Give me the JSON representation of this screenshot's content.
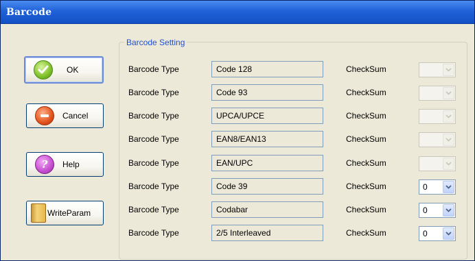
{
  "window": {
    "title": "Barcode"
  },
  "buttons": {
    "ok": {
      "label": "OK",
      "icon": "checkmark-icon"
    },
    "cancel": {
      "label": "Cancel",
      "icon": "minus-icon"
    },
    "help": {
      "label": "Help",
      "icon": "question-icon"
    },
    "write_param": {
      "label": "WriteParam",
      "icon": "book-icon"
    }
  },
  "group": {
    "legend": "Barcode Setting"
  },
  "rows": [
    {
      "label": "Barcode Type",
      "type": "Code 128",
      "checksum_label": "CheckSum",
      "checksum_value": "",
      "checksum_enabled": false
    },
    {
      "label": "Barcode Type",
      "type": "Code 93",
      "checksum_label": "CheckSum",
      "checksum_value": "",
      "checksum_enabled": false
    },
    {
      "label": "Barcode Type",
      "type": "UPCA/UPCE",
      "checksum_label": "CheckSum",
      "checksum_value": "",
      "checksum_enabled": false
    },
    {
      "label": "Barcode Type",
      "type": "EAN8/EAN13",
      "checksum_label": "CheckSum",
      "checksum_value": "",
      "checksum_enabled": false
    },
    {
      "label": "Barcode Type",
      "type": "EAN/UPC",
      "checksum_label": "CheckSum",
      "checksum_value": "",
      "checksum_enabled": false
    },
    {
      "label": "Barcode Type",
      "type": "Code 39",
      "checksum_label": "CheckSum",
      "checksum_value": "0",
      "checksum_enabled": true
    },
    {
      "label": "Barcode Type",
      "type": "Codabar",
      "checksum_label": "CheckSum",
      "checksum_value": "0",
      "checksum_enabled": true
    },
    {
      "label": "Barcode Type",
      "type": "2/5 Interleaved",
      "checksum_label": "CheckSum",
      "checksum_value": "0",
      "checksum_enabled": true
    }
  ],
  "colors": {
    "title_bar": "#2062d8",
    "legend_text": "#1e4fd6",
    "dialog_bg": "#ece9d8"
  }
}
